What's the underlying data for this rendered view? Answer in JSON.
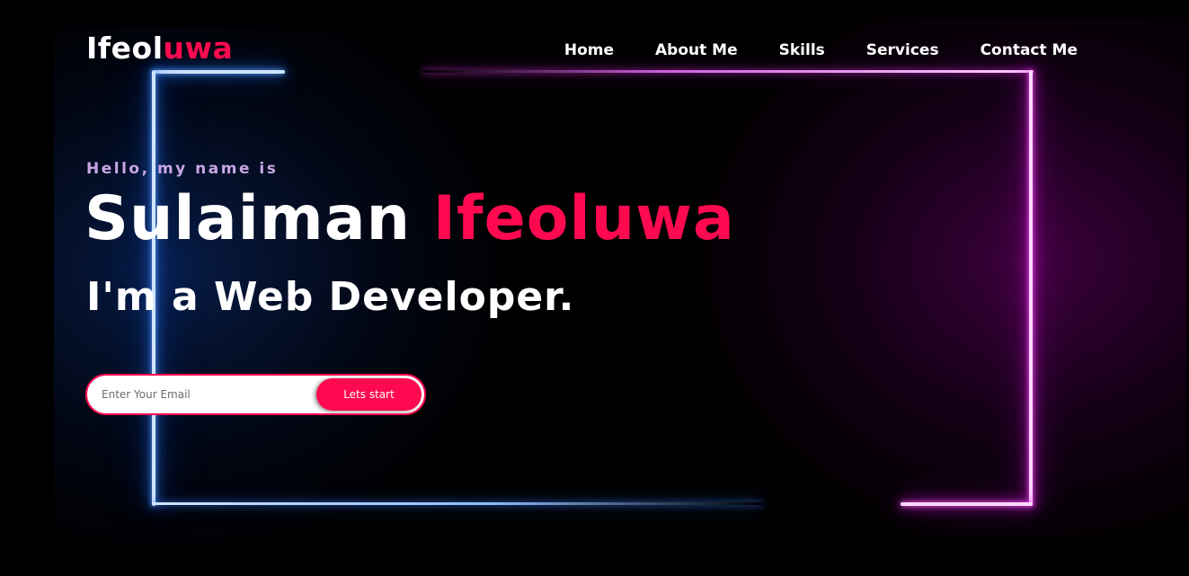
{
  "header": {
    "logo_part1": "Ifeol",
    "logo_part2": "uwa",
    "nav": [
      {
        "label": "Home"
      },
      {
        "label": "About Me"
      },
      {
        "label": "Skills"
      },
      {
        "label": "Services"
      },
      {
        "label": "Contact Me"
      }
    ]
  },
  "hero": {
    "greeting": "Hello, my name is",
    "first_name": "Sulaiman",
    "last_name": "Ifeoluwa",
    "role": "I'm a Web Developer."
  },
  "signup": {
    "email_placeholder": "Enter Your Email",
    "email_value": "",
    "button_label": "Lets start"
  },
  "colors": {
    "background": "#000000",
    "accent": "#ff0a50",
    "greeting": "#c7a6e4",
    "neon_blue": "#2f7bff",
    "neon_pink": "#f020f0"
  }
}
